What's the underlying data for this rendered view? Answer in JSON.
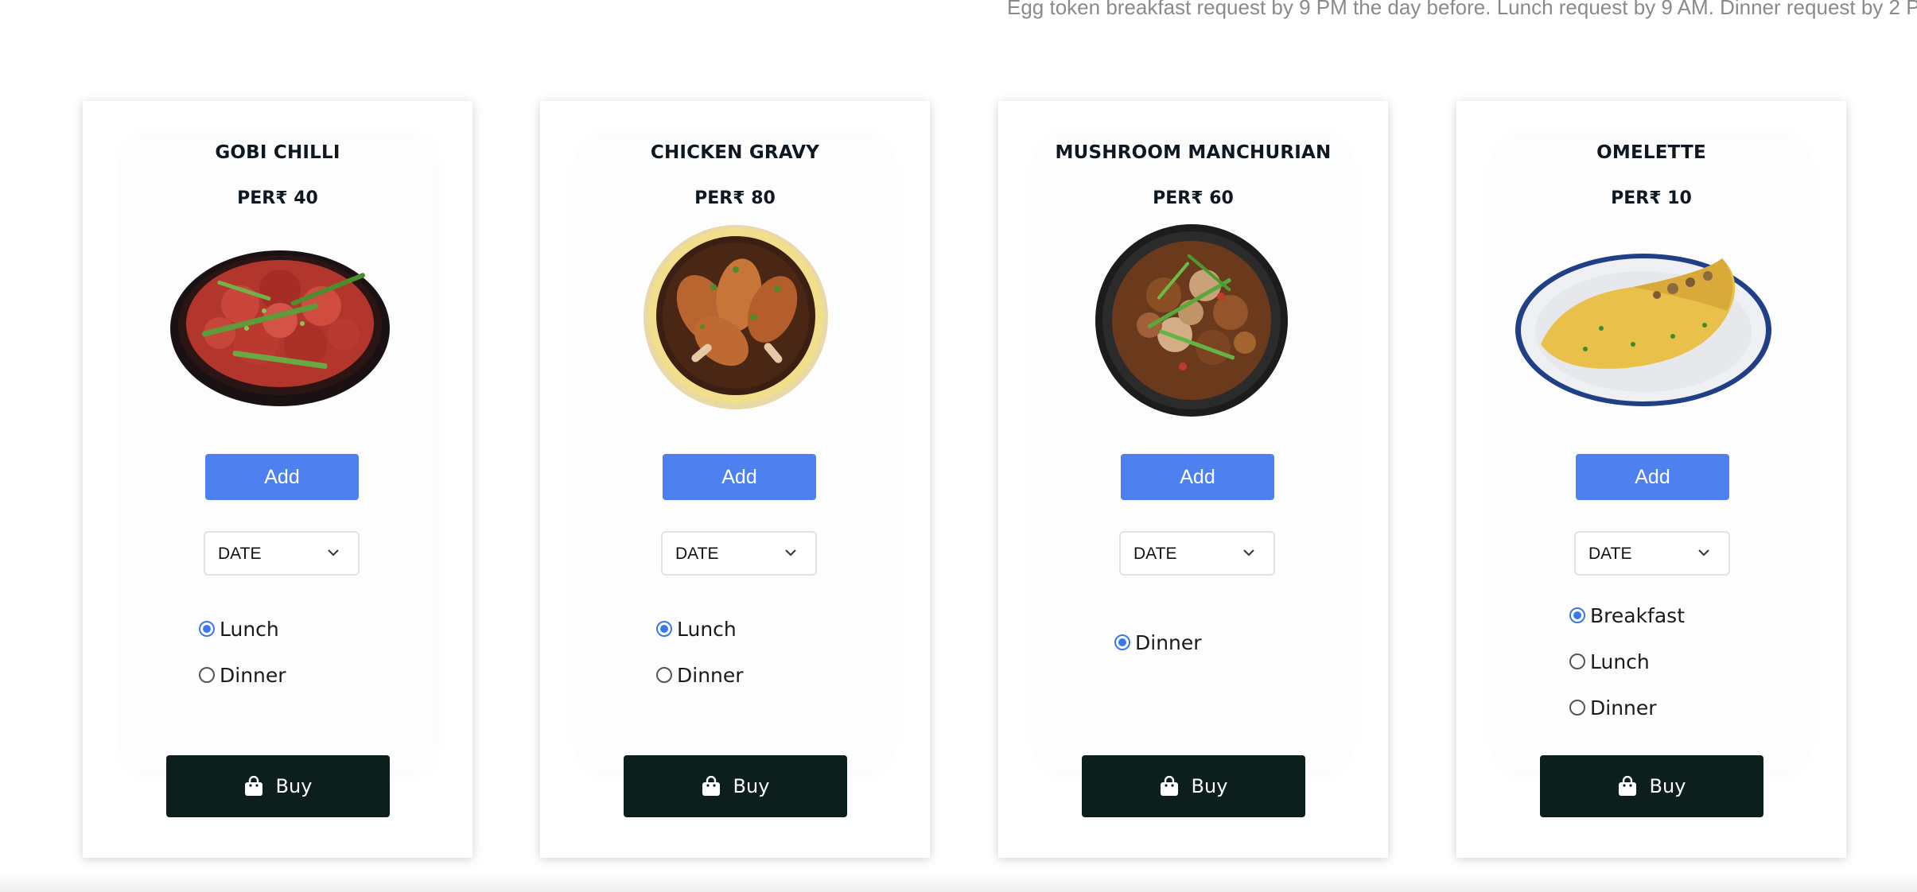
{
  "notice": "Egg token breakfast request by 9 PM the day before. Lunch request by 9 AM. Dinner request by 2 P",
  "accent_color": "#4f80ef",
  "buy_color": "#0c1f1d",
  "cards": [
    {
      "title": "GOBI CHILLI",
      "price": "PER₹ 40",
      "image": "gobi-chilli-plate",
      "add_label": "Add",
      "date_label": "DATE",
      "options": [
        {
          "label": "Lunch",
          "checked": true
        },
        {
          "label": "Dinner",
          "checked": false
        }
      ],
      "buy_label": "Buy"
    },
    {
      "title": "CHICKEN GRAVY",
      "price": "PER₹ 80",
      "image": "chicken-gravy-bowl",
      "add_label": "Add",
      "date_label": "DATE",
      "options": [
        {
          "label": "Lunch",
          "checked": true
        },
        {
          "label": "Dinner",
          "checked": false
        }
      ],
      "buy_label": "Buy"
    },
    {
      "title": "MUSHROOM MANCHURIAN",
      "price": "PER₹ 60",
      "image": "mushroom-manchurian-bowl",
      "add_label": "Add",
      "date_label": "DATE",
      "options": [
        {
          "label": "Dinner",
          "checked": true
        }
      ],
      "buy_label": "Buy"
    },
    {
      "title": "OMELETTE",
      "price": "PER₹ 10",
      "image": "omelette-plate",
      "add_label": "Add",
      "date_label": "DATE",
      "options": [
        {
          "label": "Breakfast",
          "checked": true
        },
        {
          "label": "Lunch",
          "checked": false
        },
        {
          "label": "Dinner",
          "checked": false
        }
      ],
      "buy_label": "Buy"
    }
  ]
}
